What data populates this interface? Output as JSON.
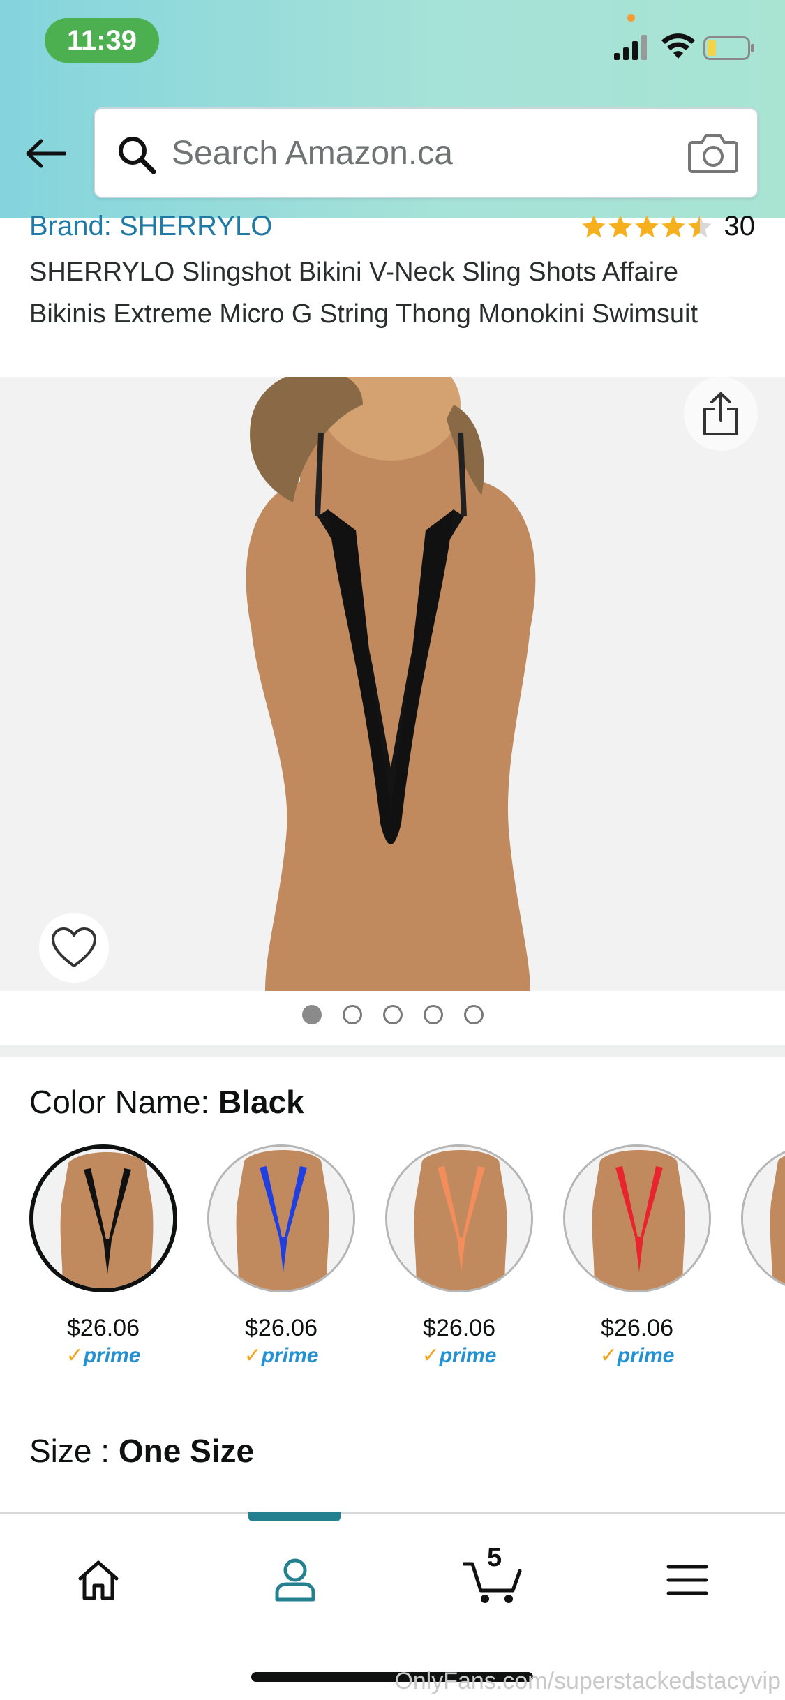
{
  "status_bar": {
    "time": "11:39"
  },
  "search": {
    "placeholder": "Search Amazon.ca"
  },
  "product": {
    "brand_link": "Brand: SHERRYLO",
    "rating": 4.5,
    "rating_count": "30",
    "title": "SHERRYLO Slingshot Bikini V-Neck Sling Shots Affaire Bikinis Extreme Micro G String Thong Monokini Swimsuit",
    "image_count": 5,
    "active_image_index": 0
  },
  "color": {
    "label": "Color Name:",
    "selected": "Black",
    "options": [
      {
        "color": "#111111",
        "price": "$26.06",
        "badge": "prime"
      },
      {
        "color": "#1f3fe0",
        "price": "$26.06",
        "badge": "prime"
      },
      {
        "color": "#f48d5c",
        "price": "$26.06",
        "badge": "prime"
      },
      {
        "color": "#e8252e",
        "price": "$26.06",
        "badge": "prime"
      }
    ]
  },
  "size": {
    "label": "Size :",
    "selected": "One Size"
  },
  "nav": {
    "cart_count": "5"
  },
  "colors": {
    "accent_teal": "#24808f",
    "link_blue": "#1f7aa7",
    "star_gold": "#f6b01e",
    "prime_blue": "#2391d2"
  },
  "watermark": "OnlyFans.com/superstackedstacyvip"
}
